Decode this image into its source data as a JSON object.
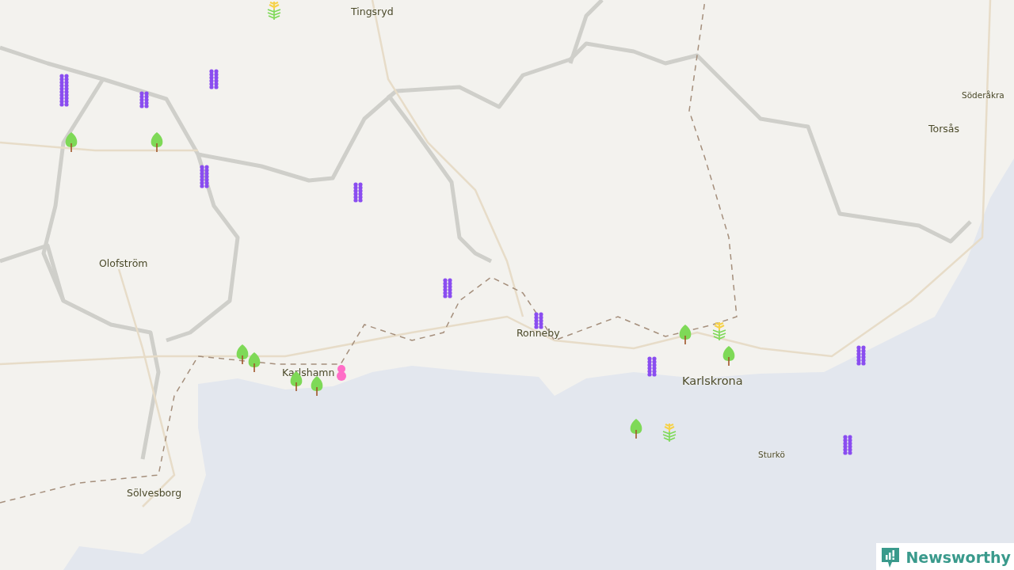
{
  "map": {
    "places": [
      {
        "name": "Tingsryd",
        "kind": "town"
      },
      {
        "name": "Söderåkra",
        "kind": "village"
      },
      {
        "name": "Torsås",
        "kind": "town"
      },
      {
        "name": "Olofström",
        "kind": "town"
      },
      {
        "name": "Ronneby",
        "kind": "town"
      },
      {
        "name": "Karlshamn",
        "kind": "town"
      },
      {
        "name": "Karlskrona",
        "kind": "city"
      },
      {
        "name": "Sturkö",
        "kind": "village"
      },
      {
        "name": "Sölvesborg",
        "kind": "town"
      }
    ],
    "markers": [
      {
        "kind": "spike"
      },
      {
        "kind": "spike"
      },
      {
        "kind": "spike"
      },
      {
        "kind": "spike"
      },
      {
        "kind": "spike"
      },
      {
        "kind": "spike"
      },
      {
        "kind": "spike"
      },
      {
        "kind": "spike"
      },
      {
        "kind": "spike"
      },
      {
        "kind": "spike"
      },
      {
        "kind": "tree"
      },
      {
        "kind": "tree"
      },
      {
        "kind": "tree"
      },
      {
        "kind": "tree"
      },
      {
        "kind": "tree"
      },
      {
        "kind": "tree"
      },
      {
        "kind": "tree"
      },
      {
        "kind": "tree"
      },
      {
        "kind": "tree"
      },
      {
        "kind": "grass"
      },
      {
        "kind": "grass"
      },
      {
        "kind": "grass"
      },
      {
        "kind": "blossom"
      }
    ]
  },
  "logo": {
    "text": "Newsworthy"
  }
}
